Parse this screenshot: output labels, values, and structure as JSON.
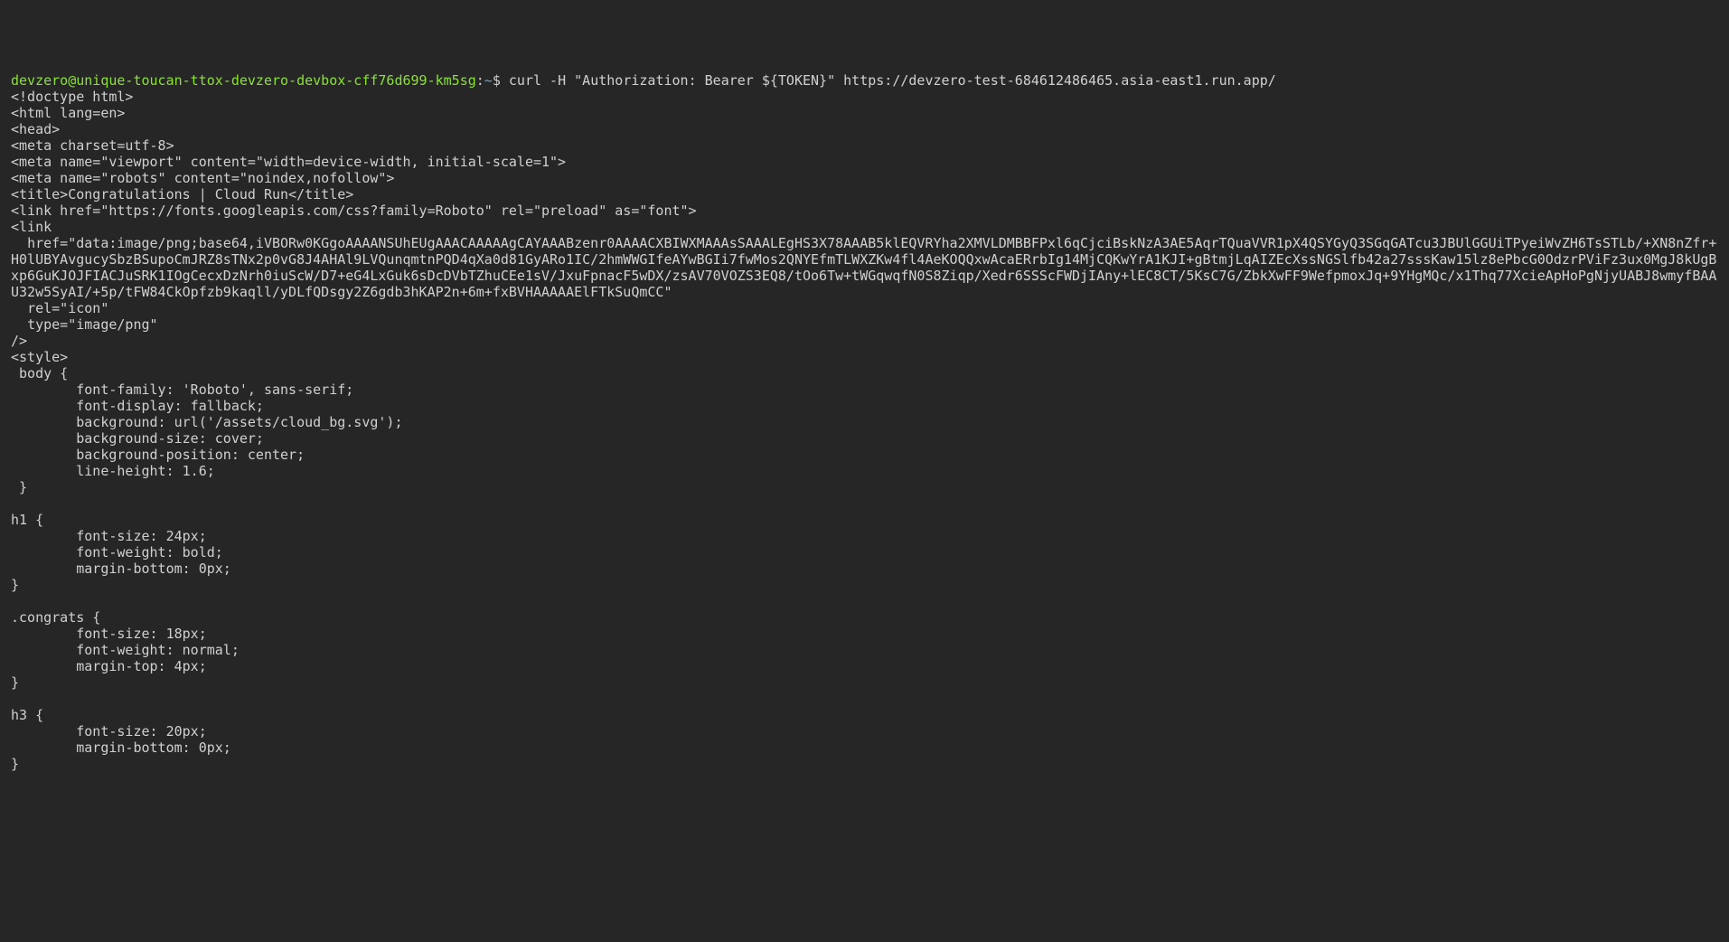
{
  "prompt": {
    "userhost": "devzero@unique-toucan-ttox-devzero-devbox-cff76d699-km5sg",
    "sep": ":",
    "cwd": "~",
    "dollar": "$ ",
    "command": "curl -H \"Authorization: Bearer ${TOKEN}\" https://devzero-test-684612486465.asia-east1.run.app/"
  },
  "output": {
    "l01": "<!doctype html>",
    "l02": "<html lang=en>",
    "l03": "<head>",
    "l04": "<meta charset=utf-8>",
    "l05": "<meta name=\"viewport\" content=\"width=device-width, initial-scale=1\">",
    "l06": "<meta name=\"robots\" content=\"noindex,nofollow\">",
    "l07": "<title>Congratulations | Cloud Run</title>",
    "l08": "<link href=\"https://fonts.googleapis.com/css?family=Roboto\" rel=\"preload\" as=\"font\">",
    "l09": "<link",
    "l10": "  href=\"data:image/png;base64,iVBORw0KGgoAAAANSUhEUgAAACAAAAAgCAYAAABzenr0AAAACXBIWXMAAAsSAAALEgHS3X78AAAB5klEQVRYha2XMVLDMBBFPxl6qCjciBskNzA3AE5AqrTQuaVVR1pX4QSYGyQ3SGqGATcu3JBUlGGUiTPyeiWvZH6TsSTLb/+XN8nZfr+H0lUBYAvgucySbzBSupoCmJRZ8sTNx2p0vG8J4AHAl9LVQunqmtnPQD4qXa0d81GyARo1IC/2hmWWGIfeAYwBGIi7fwMos2QNYEfmTLWXZKw4fl4AeKOQQxwAcaERrbIg14MjCQKwYrA1KJI+gBtmjLqAIZEcXssNGSlfb42a27sssKaw15lz8ePbcG0OdzrPViFz3ux0MgJ8kUgBxp6GuKJOJFIACJuSRK1IOgCecxDzNrh0iuScW/D7+eG4LxGuk6sDcDVbTZhuCEe1sV/JxuFpnacF5wDX/zsAV70VOZS3EQ8/tOo6Tw+tWGqwqfN0S8Ziqp/Xedr6SSScFWDjIAny+lEC8CT/5KsC7G/ZbkXwFF9WefpmoxJq+9YHgMQc/x1Thq77XcieApHoPgNjyUABJ8wmyfBAAU32w5SyAI/+5p/tFW84CkOpfzb9kaqll/yDLfQDsgy2Z6gdb3hKAP2n+6m+fxBVHAAAAAElFTkSuQmCC\"",
    "l11": "  rel=\"icon\"",
    "l12": "  type=\"image/png\"",
    "l13": "/>",
    "l14": "<style>",
    "l15": " body {",
    "l16": "        font-family: 'Roboto', sans-serif;",
    "l17": "        font-display: fallback;",
    "l18": "        background: url('/assets/cloud_bg.svg');",
    "l19": "        background-size: cover;",
    "l20": "        background-position: center;",
    "l21": "        line-height: 1.6;",
    "l22": " }",
    "l23": "",
    "l24": "h1 {",
    "l25": "        font-size: 24px;",
    "l26": "        font-weight: bold;",
    "l27": "        margin-bottom: 0px;",
    "l28": "}",
    "l29": "",
    "l30": ".congrats {",
    "l31": "        font-size: 18px;",
    "l32": "        font-weight: normal;",
    "l33": "        margin-top: 4px;",
    "l34": "}",
    "l35": "",
    "l36": "h3 {",
    "l37": "        font-size: 20px;",
    "l38": "        margin-bottom: 0px;",
    "l39": "}"
  }
}
